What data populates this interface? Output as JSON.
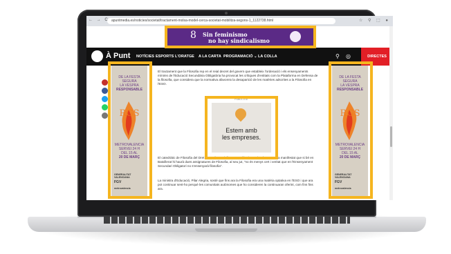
{
  "browser": {
    "url": "apuntmedia.es/noticies/societat/tractament-molsa-model-cerca-societat-mobilitza-segons-1_1122738.html",
    "nav_glyphs": "← → C",
    "ext_glyphs": "☆ ⚲ ⬚ ●"
  },
  "top_banner": {
    "logo_glyph": "8",
    "line1": "Sin feminismo",
    "line2": "no hay sindicalismo",
    "bg": "#5b2a86"
  },
  "site_nav": {
    "brand": "À Punt",
    "items": [
      "NOTÍCIES",
      "ESPORTS",
      "L'ORATGE",
      "A LA CARTA",
      "PROGRAMACIÓ ⌄",
      "LA COLLA"
    ],
    "live_label": "DIRECTES",
    "live_color": "#e21f26"
  },
  "side_ad": {
    "line1": "DE LA FESTA",
    "line2": "SEGURA",
    "line3": "LA VESPRA",
    "line4": "RESPONSABLE",
    "brand": "RGS",
    "m1": "METROVALENCIA",
    "m2": "SERVEI 24 H",
    "m3": "DEL 15 AL",
    "m4": "20 DE MARÇ",
    "g1": "GENERALITAT VALENCIANA",
    "g2": "FGV",
    "g3": "metrovalencia"
  },
  "article": {
    "p1": "El tractament que la Filosofia rep en el reial decret del govern que estableix l'ordenació i els ensenyaments mínims de l'Educació Secundària Obligatòria ha provocat les crítiques d'entitats com la Plataforma en Defensa de la filosofia, que considera que la normativa afavoreix la desaparició de les matèries adscrites a la Filosofia en l'ESO.",
    "p2": "El catedràtic de Filosofia del Dret i senador socialista per València, Javier de Lucas, ha manifestat que si bé en Batxillerat hi haurà dues assignatures de Filosofia, al seu jut, \"no és menys cert i veritat que en l'Ensenyament Secundari Obligatori no s'ensenyarà filosofia\".",
    "p3": "La ministra d'Educació, Pilar Alegria, sosté que fins ara la Filosofia era una matèria optativa en l'ESO i que ara pot continuar sent-ho perquè les comunitats autònomes que ho consideren la continuaran oferint, com fins fins ara."
  },
  "mid_ad": {
    "label": "PUBLICITAT",
    "line1": "Estem amb",
    "line2": "les empreses."
  },
  "highlight_color": "#f5b51f",
  "social_colors": [
    "#c4302b",
    "#3b5998",
    "#1da1f2",
    "#25d366",
    "#777777"
  ]
}
